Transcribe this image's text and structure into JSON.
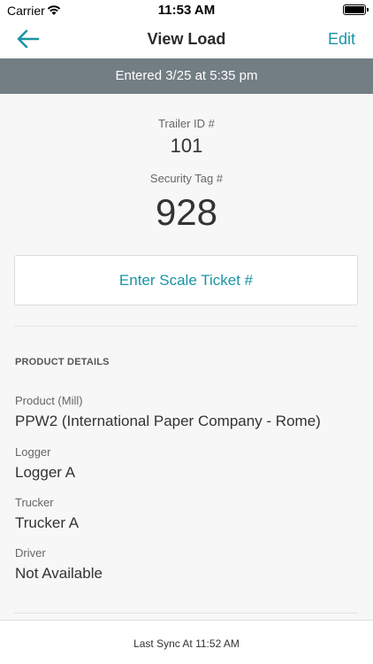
{
  "status_bar": {
    "carrier": "Carrier",
    "time": "11:53 AM"
  },
  "nav": {
    "title": "View Load",
    "edit_label": "Edit",
    "back_icon": "arrow-left-icon",
    "accent_color": "#1a94a6"
  },
  "banner": {
    "text": "Entered 3/25 at 5:35 pm",
    "background": "#737d84"
  },
  "load": {
    "trailer_label": "Trailer ID #",
    "trailer_value": "101",
    "security_label": "Security Tag #",
    "security_value": "928"
  },
  "scale_ticket": {
    "button_label": "Enter Scale Ticket #"
  },
  "product_details": {
    "section_title": "PRODUCT DETAILS",
    "fields": [
      {
        "label": "Product (Mill)",
        "value": "PPW2 (International Paper Company - Rome)"
      },
      {
        "label": "Logger",
        "value": "Logger A"
      },
      {
        "label": "Trucker",
        "value": "Trucker A"
      },
      {
        "label": "Driver",
        "value": "Not Available"
      }
    ]
  },
  "footer": {
    "sync_text": "Last Sync At 11:52 AM"
  }
}
